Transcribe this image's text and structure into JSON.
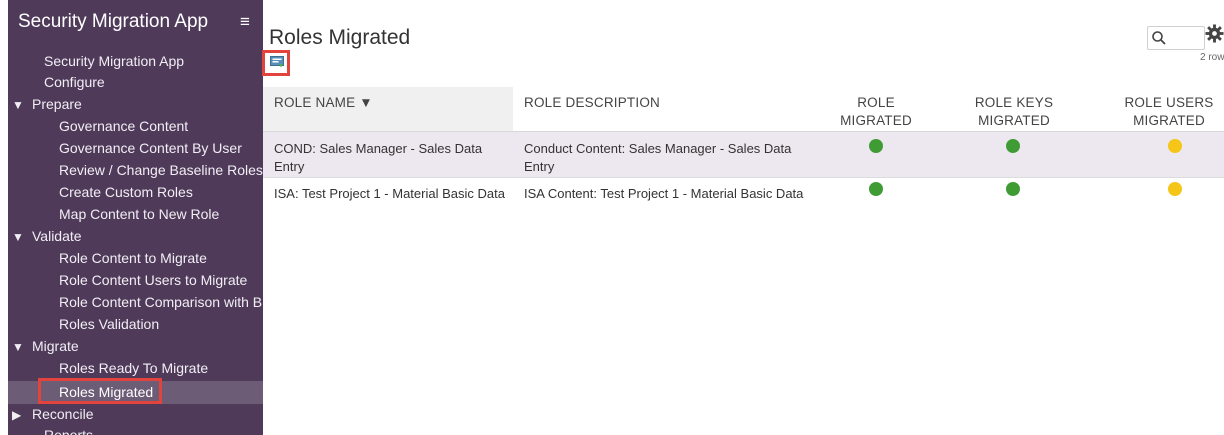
{
  "sidebar": {
    "app_title": "Security Migration App",
    "items": [
      {
        "label": "Security Migration App"
      },
      {
        "label": "Configure"
      },
      {
        "label": "Prepare"
      },
      {
        "label": "Governance Content"
      },
      {
        "label": "Governance Content By User"
      },
      {
        "label": "Review / Change Baseline Roles"
      },
      {
        "label": "Create Custom Roles"
      },
      {
        "label": "Map Content to New Role"
      },
      {
        "label": "Validate"
      },
      {
        "label": "Role Content to Migrate"
      },
      {
        "label": "Role Content Users to Migrate"
      },
      {
        "label": "Role Content Comparison with B"
      },
      {
        "label": "Roles Validation"
      },
      {
        "label": "Migrate"
      },
      {
        "label": "Roles Ready To Migrate"
      },
      {
        "label": "Roles Migrated"
      },
      {
        "label": "Reconcile"
      },
      {
        "label": "Reports"
      }
    ],
    "expanded_glyph": "▼",
    "collapsed_glyph": "▶",
    "menu_glyph": "≡"
  },
  "main": {
    "title": "Roles Migrated",
    "row_count": "2 row",
    "table": {
      "headers": [
        {
          "line1": "ROLE NAME ▼",
          "line2": ""
        },
        {
          "line1": "ROLE DESCRIPTION",
          "line2": ""
        },
        {
          "line1": "ROLE",
          "line2": "MIGRATED"
        },
        {
          "line1": "ROLE KEYS",
          "line2": "MIGRATED"
        },
        {
          "line1": "ROLE USERS",
          "line2": "MIGRATED"
        }
      ],
      "rows": [
        {
          "name": "COND: Sales Manager - Sales Data Entry",
          "description": "Conduct Content: Sales Manager - Sales Data Entry",
          "status": [
            "green",
            "green",
            "yellow"
          ]
        },
        {
          "name": "ISA: Test Project 1 - Material Basic Data",
          "description": "ISA Content: Test Project 1 - Material Basic Data",
          "status": [
            "green",
            "green",
            "yellow"
          ]
        }
      ]
    }
  },
  "colors": {
    "sidebar_bg": "#4f3a5a",
    "highlight_red": "#e2433c",
    "status_green": "#3f9c35",
    "status_yellow": "#f5c518"
  },
  "icons": [
    "export-icon",
    "search-icon",
    "gear-icon"
  ]
}
